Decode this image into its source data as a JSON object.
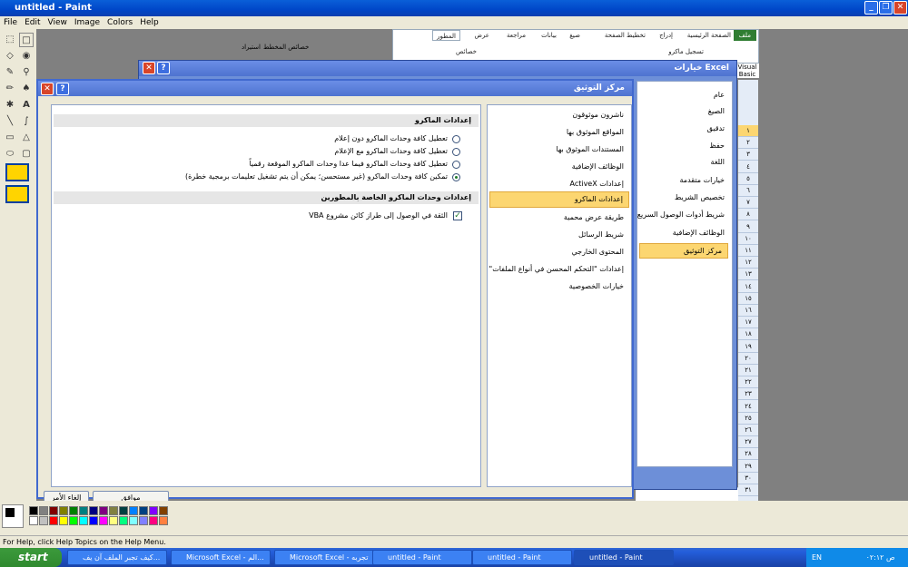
{
  "paint": {
    "title": "untitled - Paint",
    "menu": [
      "File",
      "Edit",
      "View",
      "Image",
      "Colors",
      "Help"
    ],
    "status": "For Help, click Help Topics on the Help Menu.",
    "palette": [
      "#000000",
      "#808080",
      "#800000",
      "#808000",
      "#008000",
      "#008080",
      "#000080",
      "#800080",
      "#808040",
      "#004040",
      "#0080ff",
      "#004080",
      "#8000ff",
      "#804000",
      "#ffffff",
      "#c0c0c0",
      "#ff0000",
      "#ffff00",
      "#00ff00",
      "#00ffff",
      "#0000ff",
      "#ff00ff",
      "#ffff80",
      "#00ff80",
      "#80ffff",
      "#8080ff",
      "#ff0080",
      "#ff8040"
    ]
  },
  "excel": {
    "tabs": [
      "ملف",
      "الصفحة الرئيسية",
      "إدراج",
      "تخطيط الصفحة",
      "صيغ",
      "بيانات",
      "مراجعة",
      "عرض",
      "المطور"
    ],
    "ribbon_labels": [
      "تسجيل ماكرو",
      "خصائص",
      "خصائص المخطط",
      "استيراد",
      "Visual Basic"
    ],
    "rows": [
      "١",
      "٢",
      "٣",
      "٤",
      "٥",
      "٦",
      "٧",
      "٨",
      "٩",
      "١٠",
      "١١",
      "١٢",
      "١٣",
      "١٤",
      "١٥",
      "١٦",
      "١٧",
      "١٨",
      "١٩",
      "٢٠",
      "٢١",
      "٢٢",
      "٢٣",
      "٢٤",
      "٢٥",
      "٢٦",
      "٢٧",
      "٢٨",
      "٢٩",
      "٣٠",
      "٣١"
    ]
  },
  "options_dialog": {
    "title": "خيارات Excel",
    "nav": [
      "عام",
      "الصيغ",
      "تدقيق",
      "حفظ",
      "اللغة",
      "خيارات متقدمة",
      "تخصيص الشريط",
      "شريط أدوات الوصول السريع",
      "الوظائف الإضافية",
      "مركز التوثيق"
    ],
    "selected_index": 9
  },
  "trust_center": {
    "title": "مركز التوثيق",
    "nav": [
      "ناشرون موثوقون",
      "المواقع الموثوق بها",
      "المستندات الموثوق بها",
      "الوظائف الإضافية",
      "إعدادات ActiveX",
      "إعدادات الماكرو",
      "طريقة عرض محمية",
      "شريط الرسائل",
      "المحتوى الخارجي",
      "إعدادات \"التحكم المحسن في أنواع الملفات\"",
      "خيارات الخصوصية"
    ],
    "selected_index": 5,
    "macro_section_title": "إعدادات الماكرو",
    "macro_options": [
      "تعطيل كافة وحدات الماكرو دون إعلام",
      "تعطيل كافة وحدات الماكرو مع الإعلام",
      "تعطيل كافة وحدات الماكرو فيما عدا وحدات الماكرو الموقعة رقمياً",
      "تمكين كافة وحدات الماكرو (غير مستحسن؛ يمكن أن يتم تشغيل تعليمات برمجية خطرة)"
    ],
    "selected_option": 3,
    "developer_section_title": "إعدادات وحدات الماكرو الخاصة بالمطورين",
    "vba_trust_label": "الثقة في الوصول إلى طراز كائن مشروع VBA",
    "vba_trust_checked": true,
    "ok_label": "موافق",
    "cancel_label": "إلغاء الأمر"
  },
  "taskbar": {
    "start": "start",
    "tasks": [
      "كيف تجبر الملف آن يف...",
      "Microsoft Excel - الم...",
      "Microsoft Excel - تجربه",
      "untitled - Paint",
      "untitled - Paint",
      "untitled - Paint"
    ],
    "tray_lang": "EN",
    "clock": "ص ٠٢:١٢"
  }
}
